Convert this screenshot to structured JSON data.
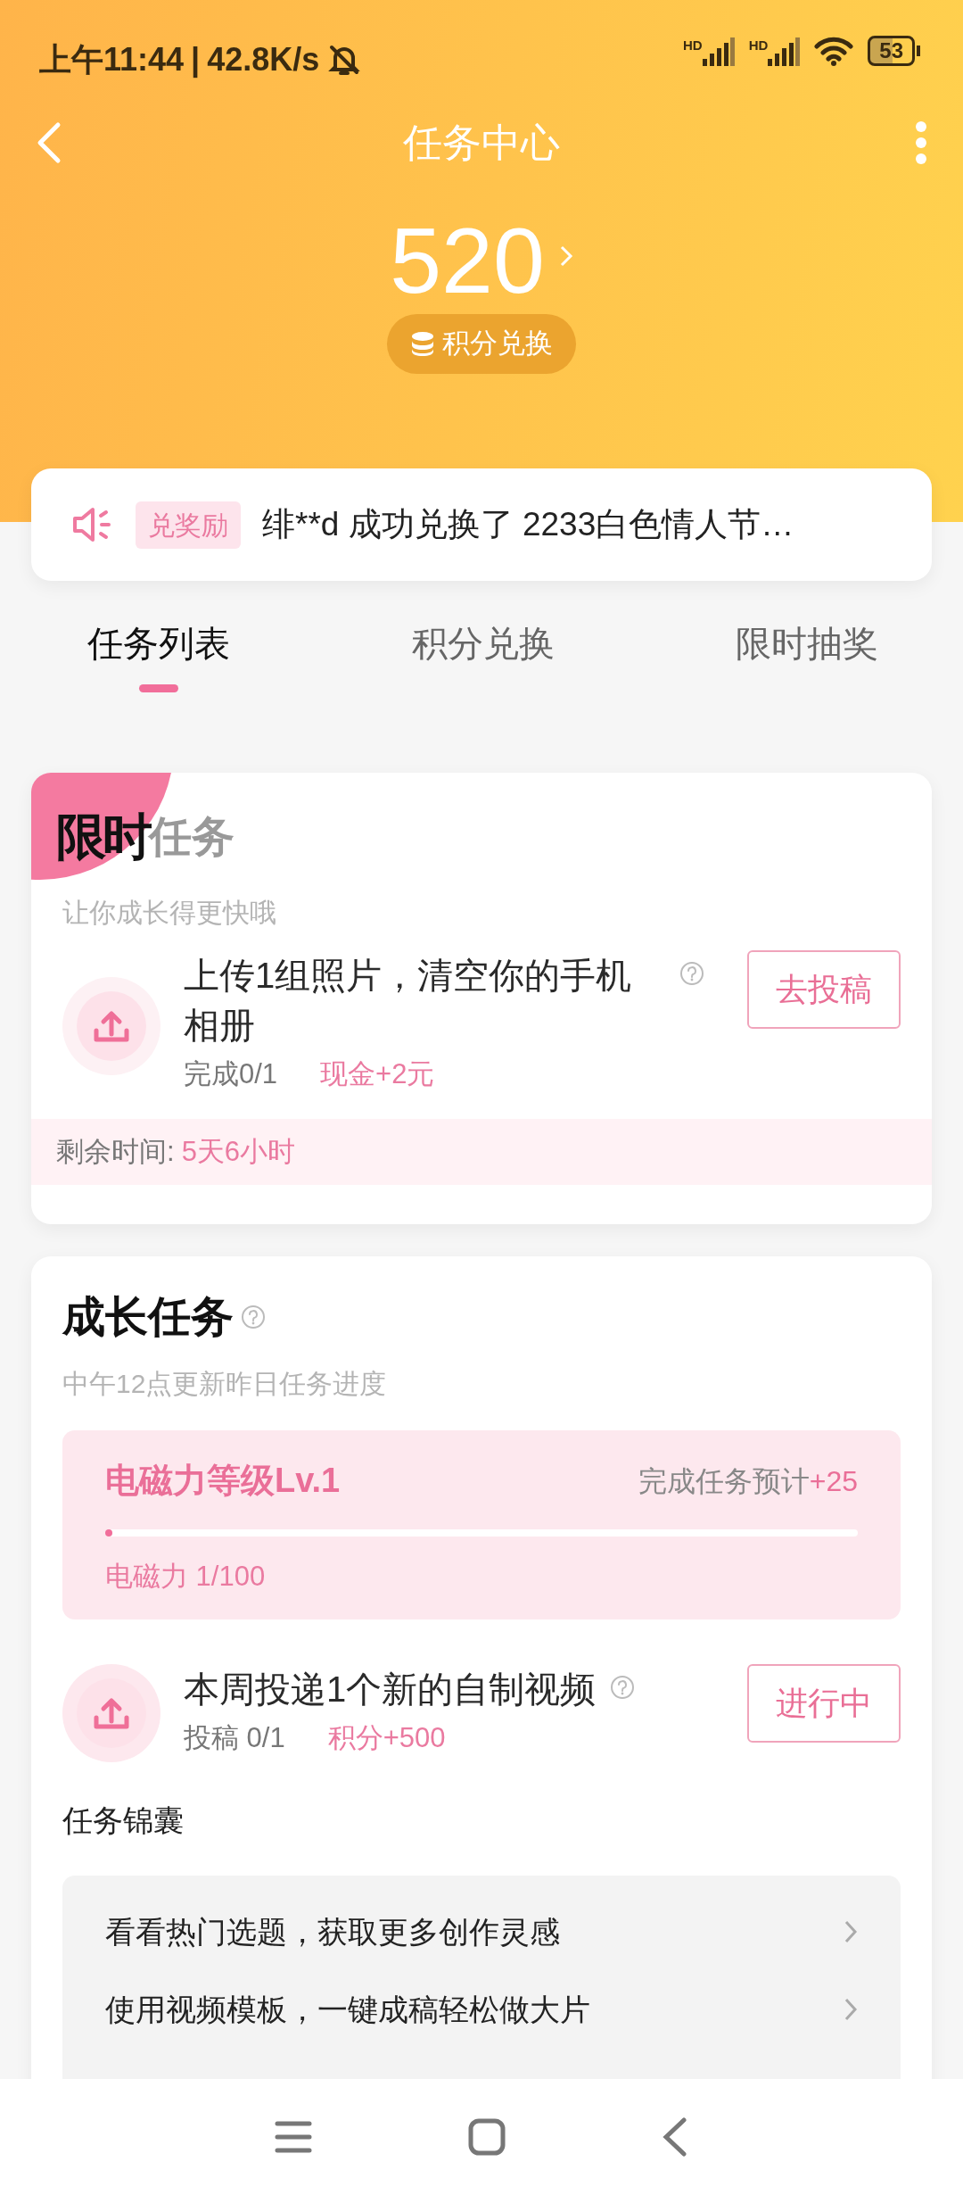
{
  "status_bar": {
    "time": "上午11:44",
    "separator": "|",
    "speed": "42.8K/s",
    "network_tags": [
      "HD",
      "HD"
    ],
    "battery": "53"
  },
  "header": {
    "title": "任务中心"
  },
  "points": {
    "value": "520",
    "exchange_label": "积分兑换"
  },
  "notice": {
    "tag": "兑奖励",
    "text": "绯**d 成功兑换了 2233白色情人节…"
  },
  "tabs": [
    {
      "label": "任务列表",
      "selected": true
    },
    {
      "label": "积分兑换",
      "selected": false
    },
    {
      "label": "限时抽奖",
      "selected": false
    }
  ],
  "limited_card": {
    "badge": "限时",
    "title": "任务",
    "subtitle": "让你成长得更快哦",
    "task": {
      "title": "上传1组照片，清空你的手机相册",
      "progress": "完成0/1",
      "reward": "现金+2元",
      "button": "去投稿"
    },
    "remaining_label": "剩余时间:",
    "remaining": "5天6小时"
  },
  "growth_card": {
    "title": "成长任务",
    "subtitle": "中午12点更新昨日任务进度",
    "level_box": {
      "name": "电磁力等级Lv.1",
      "estimate_label": "完成任务预计",
      "estimate_value": "+25",
      "level": 0.01,
      "reading": "电磁力 1/100"
    },
    "task": {
      "title": "本周投递1个新的自制视频",
      "progress": "投稿 0/1",
      "reward": "积分+500",
      "button": "进行中"
    },
    "tips_title": "任务锦囊",
    "tips": [
      "看看热门选题，获取更多创作灵感",
      "使用视频模板，一键成稿轻松做大片"
    ]
  }
}
